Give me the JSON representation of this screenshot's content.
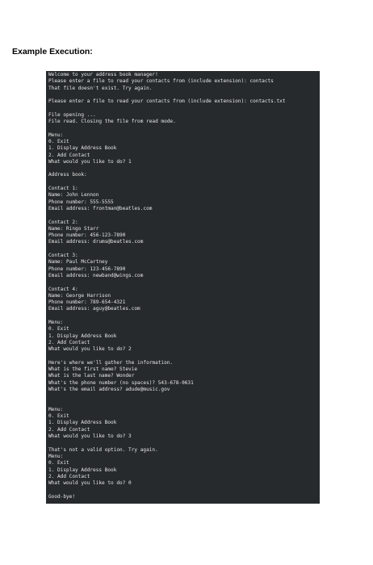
{
  "heading": "Example Execution:",
  "terminal": {
    "lines": [
      "Welcome to your address book manager!",
      "Please enter a file to read your contacts from (include extension): contacts",
      "That file doesn't exist. Try again.",
      "",
      "Please enter a file to read your contacts from (include extension): contacts.txt",
      "",
      "File opening ...",
      "File read. Closing the file from read mode.",
      "",
      "Menu:",
      "0. Exit",
      "1. Display Address Book",
      "2. Add Contact",
      "What would you like to do? 1",
      "",
      "Address book:",
      "",
      "Contact 1:",
      "Name: John Lennon",
      "Phone number: 555-5555",
      "Email address: frontman@beatles.com",
      "",
      "Contact 2:",
      "Name: Ringo Starr",
      "Phone number: 456-123-7890",
      "Email address: drums@beatles.com",
      "",
      "Contact 3:",
      "Name: Paul McCartney",
      "Phone number: 123-456-7890",
      "Email address: newband@wings.com",
      "",
      "Contact 4:",
      "Name: George Harrison",
      "Phone number: 789-654-4321",
      "Email address: aguy@beatles.com",
      "",
      "Menu:",
      "0. Exit",
      "1. Display Address Book",
      "2. Add Contact",
      "What would you like to do? 2",
      "",
      "Here's where we'll gather the information.",
      "What is the first name? Stevie",
      "What is the last name? Wonder",
      "What's the phone number (no spaces)? 543-678-0631",
      "What's the email address? adude@music.gov",
      "",
      "",
      "Menu:",
      "0. Exit",
      "1. Display Address Book",
      "2. Add Contact",
      "What would you like to do? 3",
      "",
      "That's not a valid option. Try again.",
      "Menu:",
      "0. Exit",
      "1. Display Address Book",
      "2. Add Contact",
      "What would you like to do? 0",
      "",
      "Good-bye!"
    ]
  }
}
